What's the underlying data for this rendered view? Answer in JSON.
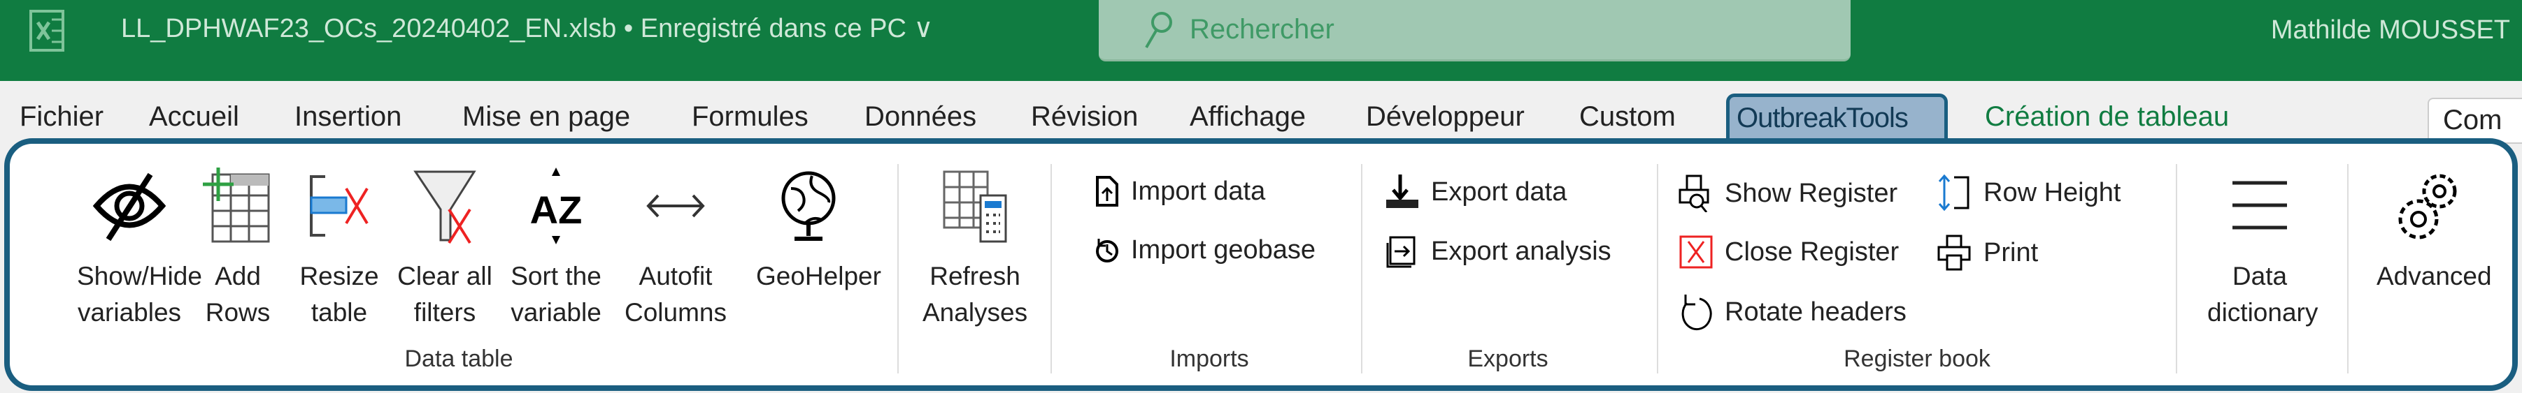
{
  "titlebar": {
    "app_icon": "excel-icon",
    "filename": "LL_DPHWAF23_OCs_20240402_EN.xlsb • Enregistré dans ce PC ∨",
    "search_placeholder": "Rechercher",
    "user": "Mathilde MOUSSET"
  },
  "tabs": [
    "Fichier",
    "Accueil",
    "Insertion",
    "Mise en page",
    "Formules",
    "Données",
    "Révision",
    "Affichage",
    "Développeur",
    "Custom",
    "OutbreakTools",
    "Création de tableau"
  ],
  "active_tab": "OutbreakTools",
  "comment_button": "Com",
  "colors": {
    "title_bar": "#107c41",
    "ribbon_border": "#1a5e80",
    "active_tab": "#97b3cc",
    "contextual_tab": "#107c41"
  },
  "groups": {
    "data_table": {
      "label": "Data table",
      "buttons": [
        {
          "l1": "Show/Hide",
          "l2": "variables"
        },
        {
          "l1": "Add",
          "l2": "Rows"
        },
        {
          "l1": "Resize",
          "l2": "table"
        },
        {
          "l1": "Clear all",
          "l2": "filters"
        },
        {
          "l1": "Sort the",
          "l2": "variable"
        },
        {
          "l1": "Autofit",
          "l2": "Columns"
        },
        {
          "l1": "GeoHelper",
          "l2": ""
        }
      ]
    },
    "refresh": {
      "l1": "Refresh",
      "l2": "Analyses"
    },
    "imports": {
      "label": "Imports",
      "items": [
        "Import data",
        "Import geobase"
      ]
    },
    "exports": {
      "label": "Exports",
      "items": [
        "Export data",
        "Export analysis"
      ]
    },
    "register": {
      "label": "Register book",
      "items": [
        "Show Register",
        "Close Register",
        "Rotate headers",
        "Row Height",
        "Print"
      ]
    },
    "dictionary": {
      "l1": "Data",
      "l2": "dictionary"
    },
    "advanced": {
      "l1": "Advanced"
    }
  }
}
